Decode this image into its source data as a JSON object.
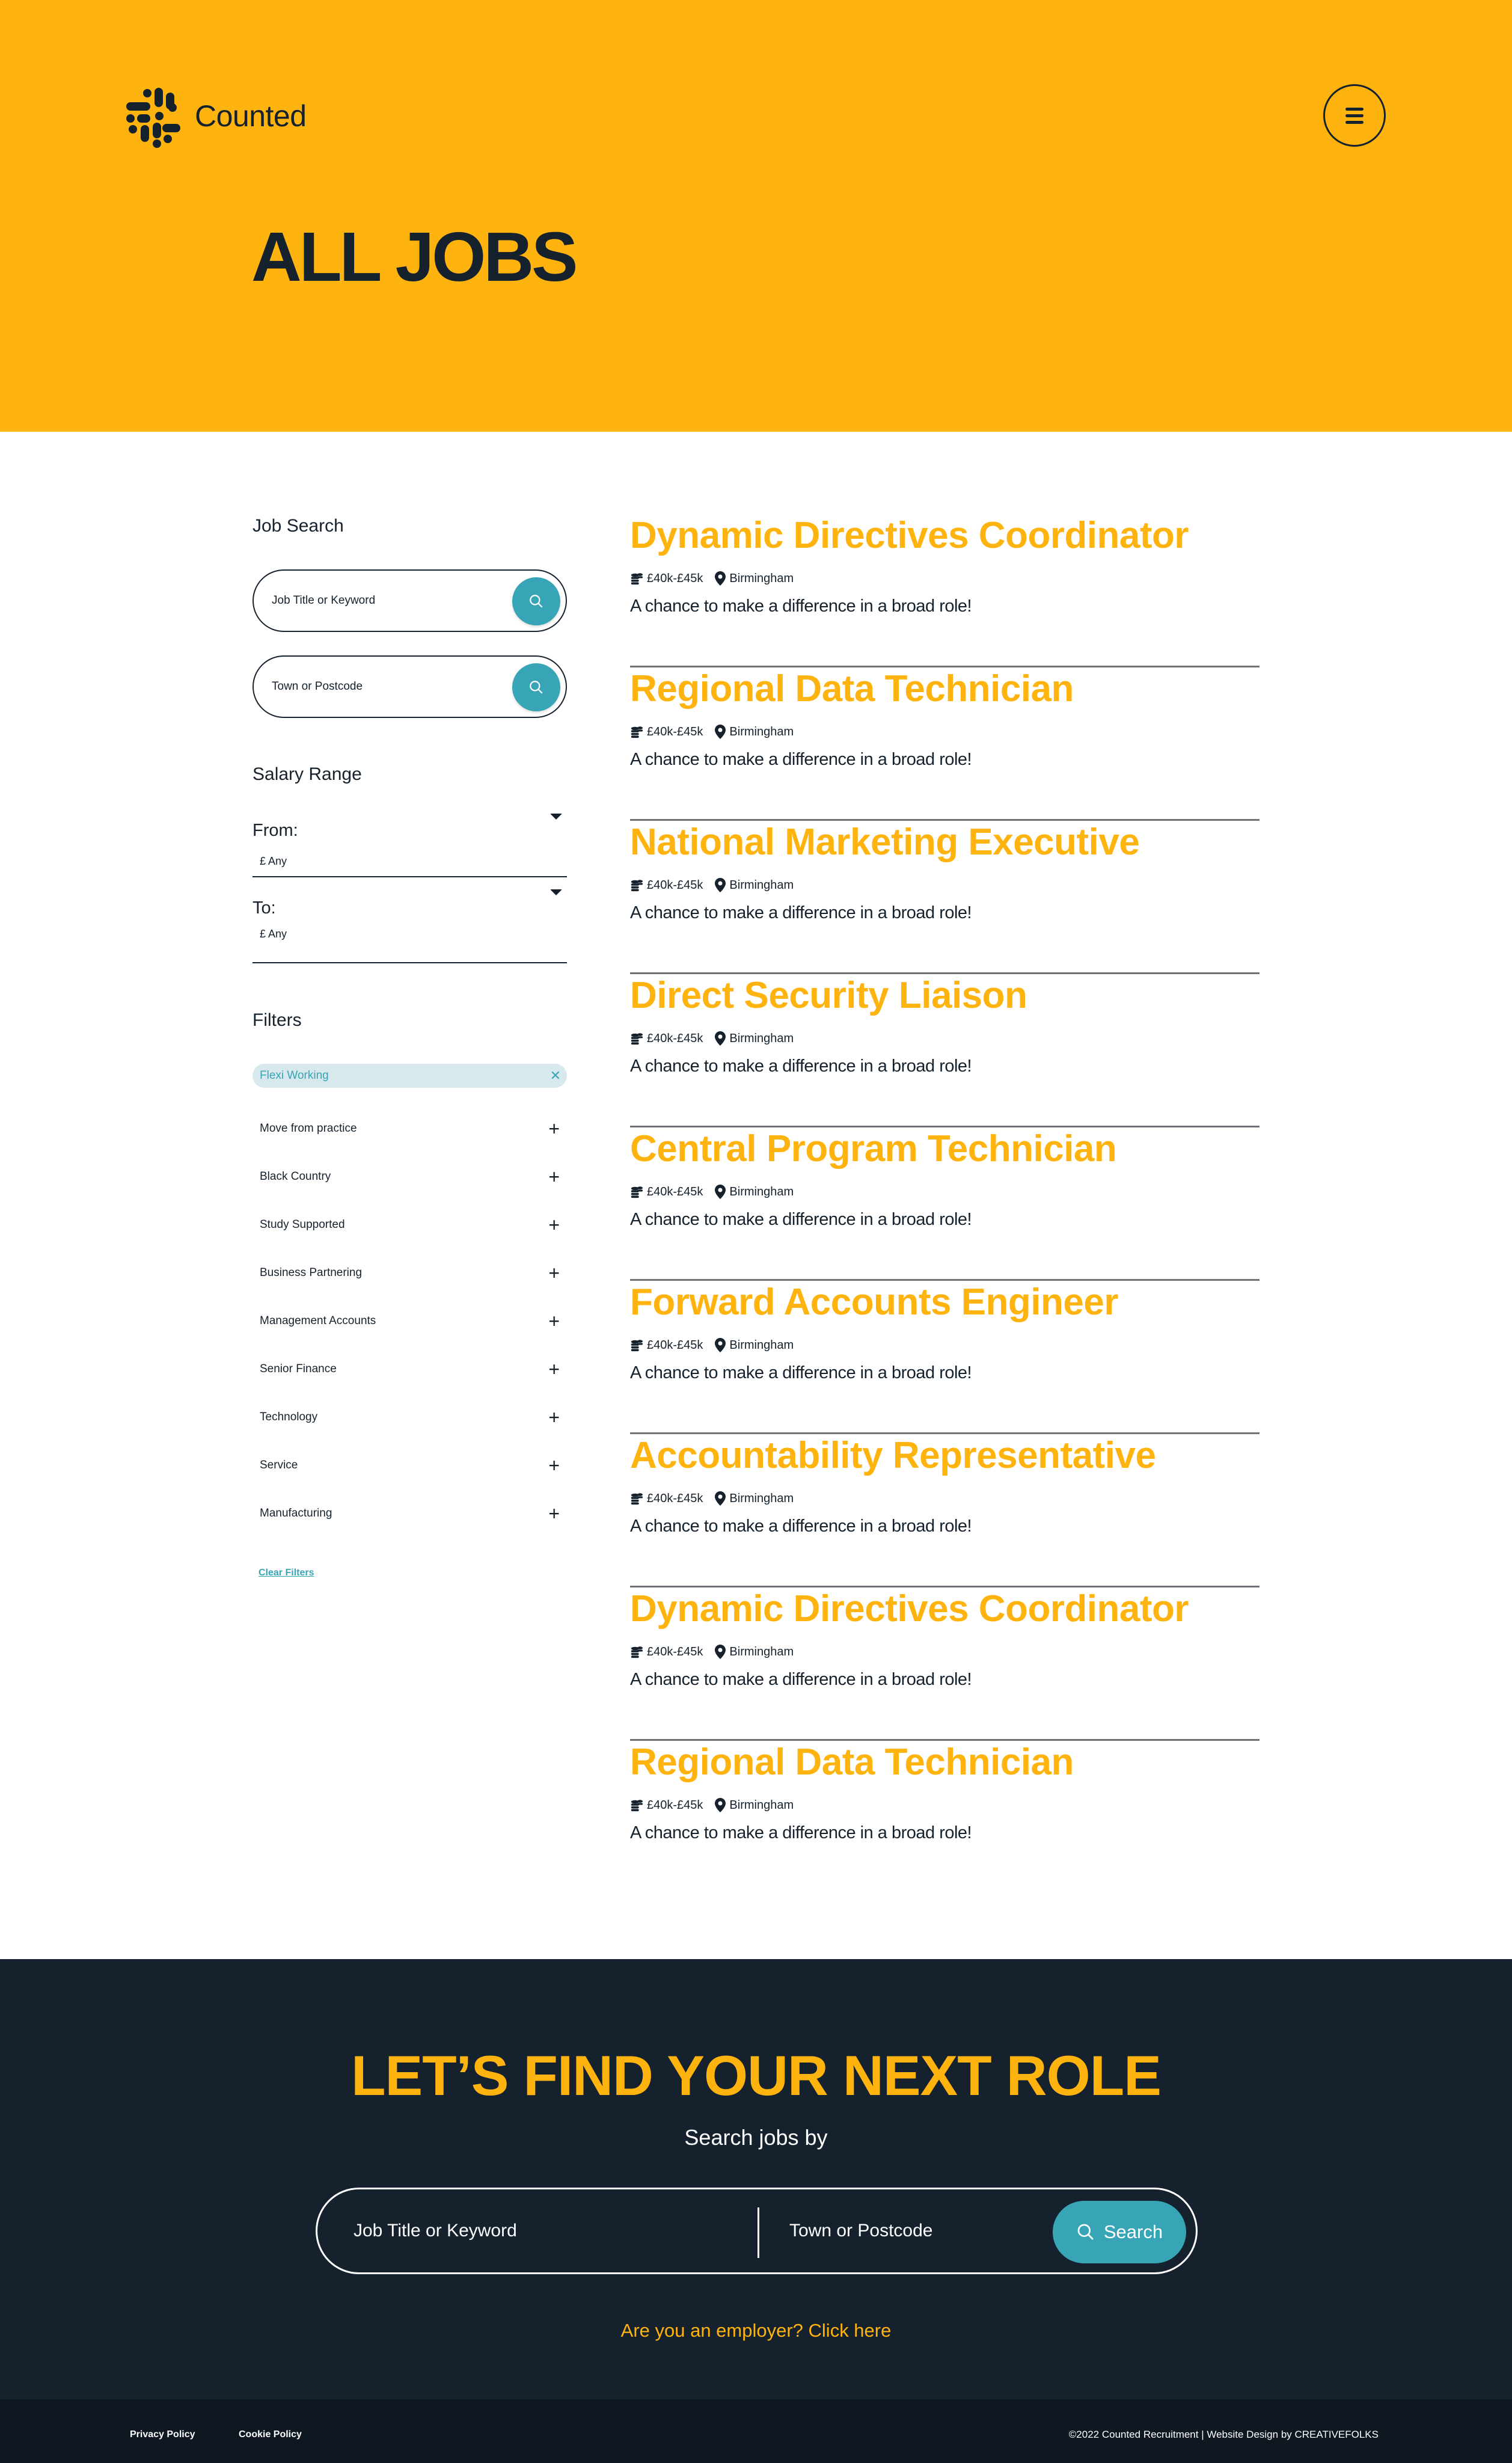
{
  "brand": {
    "name": "Counted",
    "primary_color": "#ffb30f",
    "dark_color": "#15222e",
    "accent_color": "#37a5b5"
  },
  "header": {
    "menu_icon": "hamburger-menu-icon",
    "title": "ALL JOBS"
  },
  "sidebar": {
    "job_search": {
      "heading": "Job Search",
      "keyword_placeholder": "Job Title or Keyword",
      "location_placeholder": "Town or Postcode",
      "search_icon": "search-icon"
    },
    "salary": {
      "heading": "Salary Range",
      "from_label": "From:",
      "from_value": "£ Any",
      "to_label": "To:",
      "to_value": "£ Any"
    },
    "filters": {
      "heading": "Filters",
      "active": [
        {
          "label": "Flexi Working",
          "remove_icon": "close-icon"
        }
      ],
      "items": [
        {
          "label": "Move from practice"
        },
        {
          "label": "Black Country"
        },
        {
          "label": "Study Supported"
        },
        {
          "label": "Business Partnering"
        },
        {
          "label": "Management Accounts"
        },
        {
          "label": "Senior Finance"
        },
        {
          "label": "Technology"
        },
        {
          "label": "Service"
        },
        {
          "label": "Manufacturing"
        }
      ],
      "clear_label": "Clear Filters"
    }
  },
  "jobs": [
    {
      "title": "Dynamic Directives Coordinator",
      "salary": "£40k-£45k",
      "location": "Birmingham",
      "description": "A chance to make a difference in a broad role!"
    },
    {
      "title": "Regional Data Technician",
      "salary": "£40k-£45k",
      "location": "Birmingham",
      "description": "A chance to make a difference in a broad role!"
    },
    {
      "title": "National Marketing Executive",
      "salary": "£40k-£45k",
      "location": "Birmingham",
      "description": "A chance to make a difference in a broad role!"
    },
    {
      "title": "Direct Security Liaison",
      "salary": "£40k-£45k",
      "location": "Birmingham",
      "description": "A chance to make a difference in a broad role!"
    },
    {
      "title": "Central Program Technician",
      "salary": "£40k-£45k",
      "location": "Birmingham",
      "description": "A chance to make a difference in a broad role!"
    },
    {
      "title": "Forward Accounts Engineer",
      "salary": "£40k-£45k",
      "location": "Birmingham",
      "description": "A chance to make a difference in a broad role!"
    },
    {
      "title": "Accountability Representative",
      "salary": "£40k-£45k",
      "location": "Birmingham",
      "description": "A chance to make a difference in a broad role!"
    },
    {
      "title": "Dynamic Directives Coordinator",
      "salary": "£40k-£45k",
      "location": "Birmingham",
      "description": "A chance to make a difference in a broad role!"
    },
    {
      "title": "Regional Data Technician",
      "salary": "£40k-£45k",
      "location": "Birmingham",
      "description": "A chance to make a difference in a broad role!"
    }
  ],
  "cta": {
    "title": "LET’S FIND YOUR NEXT ROLE",
    "subtitle": "Search jobs by",
    "keyword_placeholder": "Job Title or Keyword",
    "location_placeholder": "Town or Postcode",
    "search_label": "Search",
    "employer_link": "Are you an employer? Click here"
  },
  "footer": {
    "privacy": "Privacy Policy",
    "cookie": "Cookie Policy",
    "copyright": "©2022 Counted Recruitment | Website Design by CREATIVEFOLKS"
  }
}
